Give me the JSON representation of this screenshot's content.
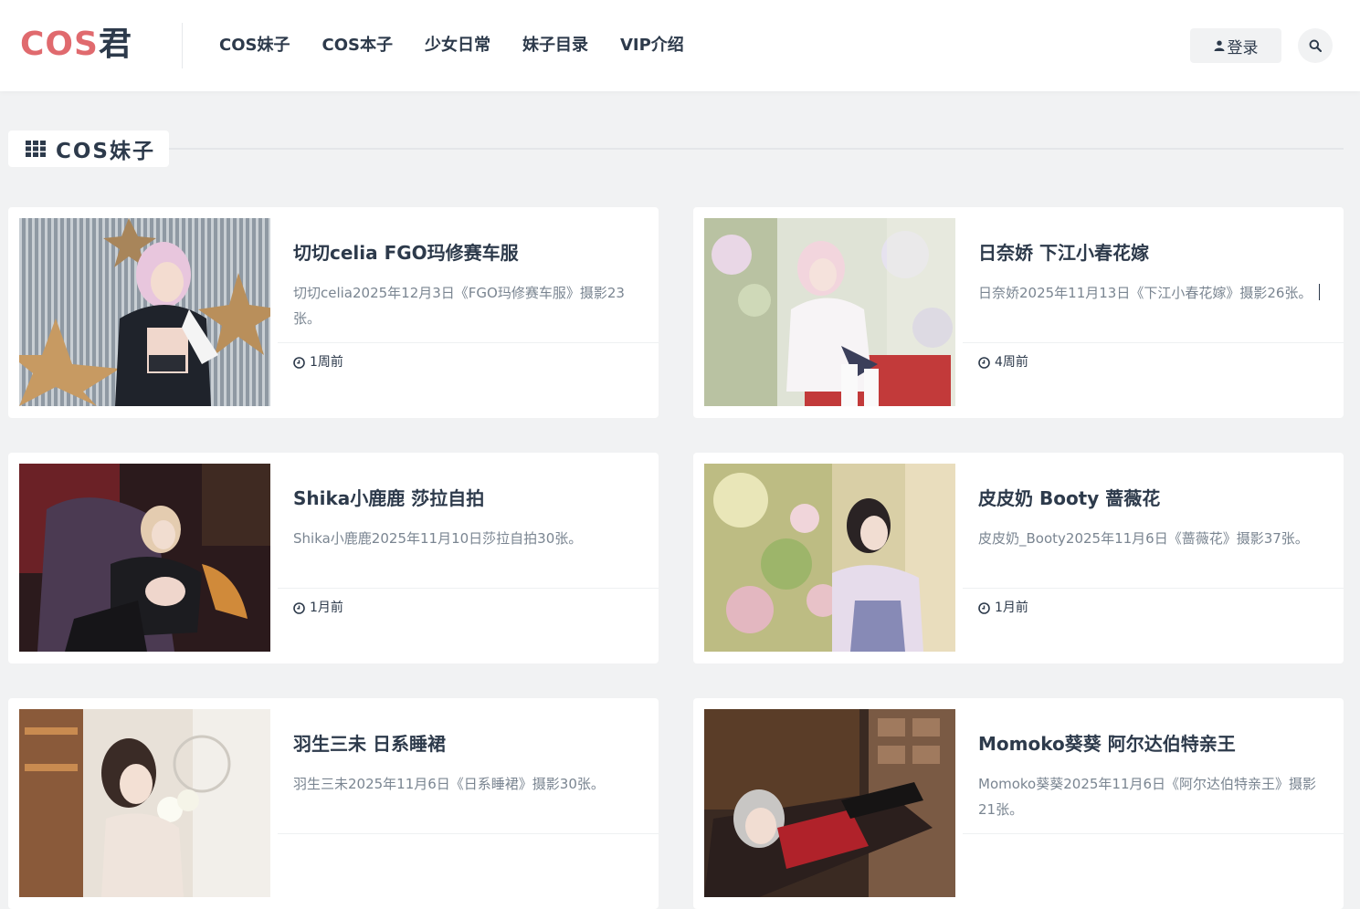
{
  "site": {
    "logo_part1": "COS",
    "logo_part2": "君",
    "logo_color": "#e06a6e"
  },
  "nav": {
    "items": [
      {
        "label": "COS妹子"
      },
      {
        "label": "COS本子"
      },
      {
        "label": "少女日常"
      },
      {
        "label": "妹子目录"
      },
      {
        "label": "VIP介绍"
      }
    ]
  },
  "header": {
    "login_label": "登录",
    "login_icon": "user-icon",
    "search_icon": "search-icon"
  },
  "section": {
    "title": "COS妹子",
    "icon": "grid-icon"
  },
  "posts": [
    {
      "title": "切切celia FGO玛修赛车服",
      "excerpt": "切切celia2025年12月3日《FGO玛修赛车服》摄影23张。",
      "time": "1周前"
    },
    {
      "title": "日奈娇 下江小春花嫁",
      "excerpt": "日奈娇2025年11月13日《下江小春花嫁》摄影26张。",
      "time": "4周前"
    },
    {
      "title": "Shika小鹿鹿 莎拉自拍",
      "excerpt": "Shika小鹿鹿2025年11月10日莎拉自拍30张。",
      "time": "1月前"
    },
    {
      "title": "皮皮奶 Booty 蔷薇花",
      "excerpt": "皮皮奶_Booty2025年11月6日《蔷薇花》摄影37张。",
      "time": "1月前"
    },
    {
      "title": "羽生三未 日系睡裙",
      "excerpt": "羽生三未2025年11月6日《日系睡裙》摄影30张。",
      "time": ""
    },
    {
      "title": "Momoko葵葵 阿尔达伯特亲王",
      "excerpt": "Momoko葵葵2025年11月6日《阿尔达伯特亲王》摄影21张。",
      "time": ""
    }
  ],
  "colors": {
    "text": "#2d3a4b",
    "muted": "#7a8591",
    "background": "#f1f2f3"
  }
}
